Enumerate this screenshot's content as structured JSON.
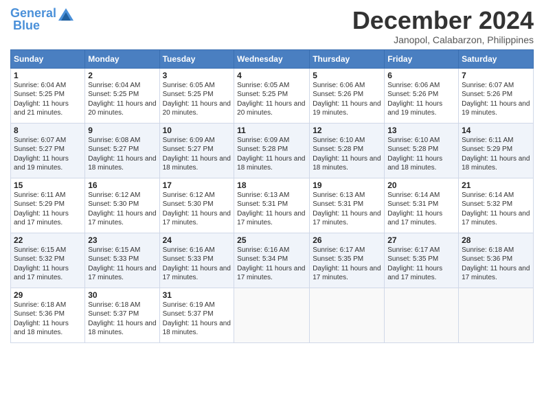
{
  "header": {
    "logo_line1": "General",
    "logo_line2": "Blue",
    "month_title": "December 2024",
    "location": "Janopol, Calabarzon, Philippines"
  },
  "weekdays": [
    "Sunday",
    "Monday",
    "Tuesday",
    "Wednesday",
    "Thursday",
    "Friday",
    "Saturday"
  ],
  "weeks": [
    [
      {
        "day": "1",
        "sunrise": "6:04 AM",
        "sunset": "5:25 PM",
        "daylight": "11 hours and 21 minutes."
      },
      {
        "day": "2",
        "sunrise": "6:04 AM",
        "sunset": "5:25 PM",
        "daylight": "11 hours and 20 minutes."
      },
      {
        "day": "3",
        "sunrise": "6:05 AM",
        "sunset": "5:25 PM",
        "daylight": "11 hours and 20 minutes."
      },
      {
        "day": "4",
        "sunrise": "6:05 AM",
        "sunset": "5:25 PM",
        "daylight": "11 hours and 20 minutes."
      },
      {
        "day": "5",
        "sunrise": "6:06 AM",
        "sunset": "5:26 PM",
        "daylight": "11 hours and 19 minutes."
      },
      {
        "day": "6",
        "sunrise": "6:06 AM",
        "sunset": "5:26 PM",
        "daylight": "11 hours and 19 minutes."
      },
      {
        "day": "7",
        "sunrise": "6:07 AM",
        "sunset": "5:26 PM",
        "daylight": "11 hours and 19 minutes."
      }
    ],
    [
      {
        "day": "8",
        "sunrise": "6:07 AM",
        "sunset": "5:27 PM",
        "daylight": "11 hours and 19 minutes."
      },
      {
        "day": "9",
        "sunrise": "6:08 AM",
        "sunset": "5:27 PM",
        "daylight": "11 hours and 18 minutes."
      },
      {
        "day": "10",
        "sunrise": "6:09 AM",
        "sunset": "5:27 PM",
        "daylight": "11 hours and 18 minutes."
      },
      {
        "day": "11",
        "sunrise": "6:09 AM",
        "sunset": "5:28 PM",
        "daylight": "11 hours and 18 minutes."
      },
      {
        "day": "12",
        "sunrise": "6:10 AM",
        "sunset": "5:28 PM",
        "daylight": "11 hours and 18 minutes."
      },
      {
        "day": "13",
        "sunrise": "6:10 AM",
        "sunset": "5:28 PM",
        "daylight": "11 hours and 18 minutes."
      },
      {
        "day": "14",
        "sunrise": "6:11 AM",
        "sunset": "5:29 PM",
        "daylight": "11 hours and 18 minutes."
      }
    ],
    [
      {
        "day": "15",
        "sunrise": "6:11 AM",
        "sunset": "5:29 PM",
        "daylight": "11 hours and 17 minutes."
      },
      {
        "day": "16",
        "sunrise": "6:12 AM",
        "sunset": "5:30 PM",
        "daylight": "11 hours and 17 minutes."
      },
      {
        "day": "17",
        "sunrise": "6:12 AM",
        "sunset": "5:30 PM",
        "daylight": "11 hours and 17 minutes."
      },
      {
        "day": "18",
        "sunrise": "6:13 AM",
        "sunset": "5:31 PM",
        "daylight": "11 hours and 17 minutes."
      },
      {
        "day": "19",
        "sunrise": "6:13 AM",
        "sunset": "5:31 PM",
        "daylight": "11 hours and 17 minutes."
      },
      {
        "day": "20",
        "sunrise": "6:14 AM",
        "sunset": "5:31 PM",
        "daylight": "11 hours and 17 minutes."
      },
      {
        "day": "21",
        "sunrise": "6:14 AM",
        "sunset": "5:32 PM",
        "daylight": "11 hours and 17 minutes."
      }
    ],
    [
      {
        "day": "22",
        "sunrise": "6:15 AM",
        "sunset": "5:32 PM",
        "daylight": "11 hours and 17 minutes."
      },
      {
        "day": "23",
        "sunrise": "6:15 AM",
        "sunset": "5:33 PM",
        "daylight": "11 hours and 17 minutes."
      },
      {
        "day": "24",
        "sunrise": "6:16 AM",
        "sunset": "5:33 PM",
        "daylight": "11 hours and 17 minutes."
      },
      {
        "day": "25",
        "sunrise": "6:16 AM",
        "sunset": "5:34 PM",
        "daylight": "11 hours and 17 minutes."
      },
      {
        "day": "26",
        "sunrise": "6:17 AM",
        "sunset": "5:35 PM",
        "daylight": "11 hours and 17 minutes."
      },
      {
        "day": "27",
        "sunrise": "6:17 AM",
        "sunset": "5:35 PM",
        "daylight": "11 hours and 17 minutes."
      },
      {
        "day": "28",
        "sunrise": "6:18 AM",
        "sunset": "5:36 PM",
        "daylight": "11 hours and 17 minutes."
      }
    ],
    [
      {
        "day": "29",
        "sunrise": "6:18 AM",
        "sunset": "5:36 PM",
        "daylight": "11 hours and 18 minutes."
      },
      {
        "day": "30",
        "sunrise": "6:18 AM",
        "sunset": "5:37 PM",
        "daylight": "11 hours and 18 minutes."
      },
      {
        "day": "31",
        "sunrise": "6:19 AM",
        "sunset": "5:37 PM",
        "daylight": "11 hours and 18 minutes."
      },
      null,
      null,
      null,
      null
    ]
  ]
}
